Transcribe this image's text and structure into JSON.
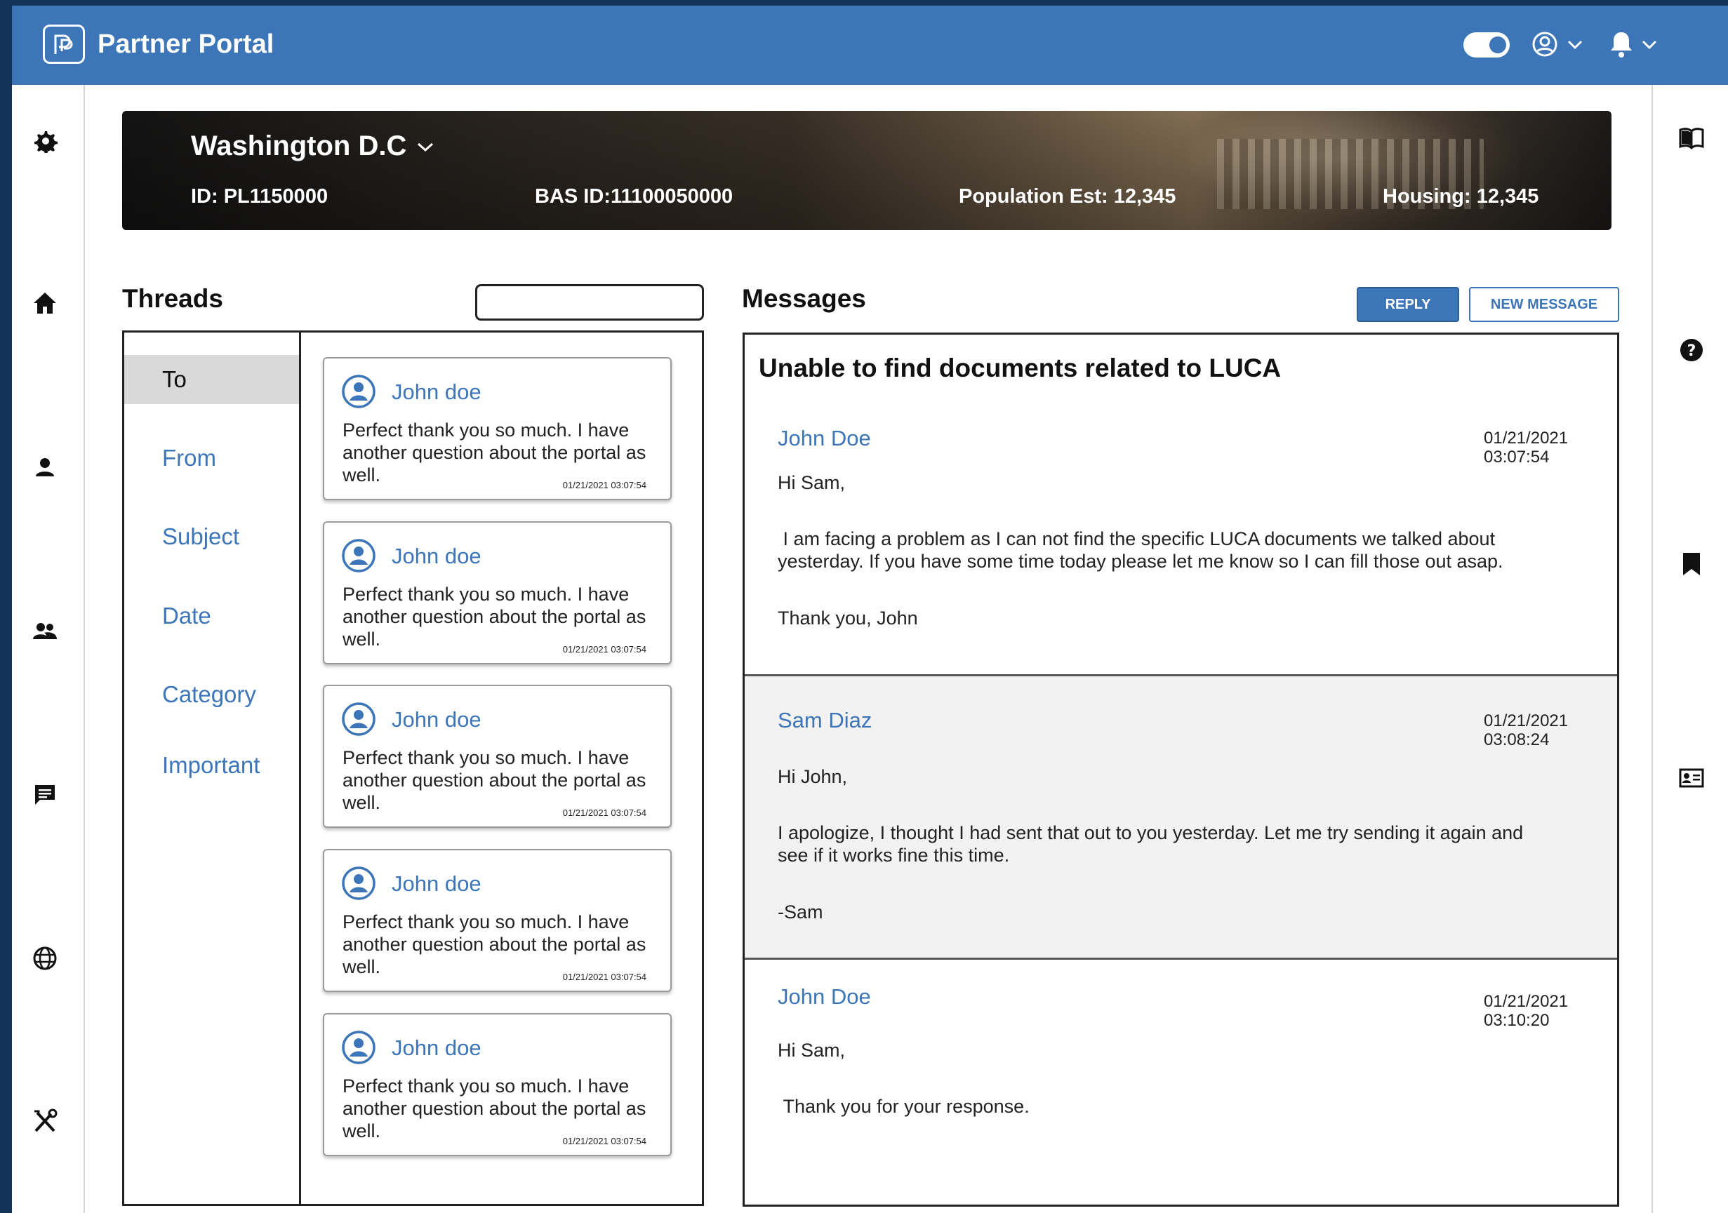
{
  "app": {
    "title": "Partner Portal",
    "accent_color": "#3d76b8"
  },
  "header_icons": [
    "toggle-switch",
    "user-circle-icon",
    "chevron-down-icon",
    "bell-icon",
    "chevron-down-icon"
  ],
  "left_rail": [
    "gear-icon",
    "home-icon",
    "person-icon",
    "group-icon",
    "chat-icon",
    "globe-icon",
    "tools-icon"
  ],
  "right_rail": [
    "book-icon",
    "help-icon",
    "bookmark-icon",
    "contact-card-icon"
  ],
  "banner": {
    "location": "Washington D.C",
    "id": "ID: PL1150000",
    "bas_id": "BAS ID:11100050000",
    "population": "Population Est: 12,345",
    "housing": "Housing: 12,345"
  },
  "threads": {
    "title": "Threads",
    "search_value": "",
    "filters": [
      "To",
      "From",
      "Subject",
      "Date",
      "Category",
      "Important"
    ],
    "active_filter": "To",
    "cards": [
      {
        "name": "John doe",
        "preview": "Perfect thank you so much. I have another question about the portal as well.",
        "time": "01/21/2021 03:07:54"
      },
      {
        "name": "John doe",
        "preview": "Perfect thank you so much. I have another question about the portal as well.",
        "time": "01/21/2021 03:07:54"
      },
      {
        "name": "John doe",
        "preview": "Perfect thank you so much. I have another question about the portal as well.",
        "time": "01/21/2021 03:07:54"
      },
      {
        "name": "John doe",
        "preview": "Perfect thank you so much. I have another question about the portal as well.",
        "time": "01/21/2021 03:07:54"
      },
      {
        "name": "John doe",
        "preview": "Perfect thank you so much. I have another question about the portal as well.",
        "time": "01/21/2021 03:07:54"
      }
    ]
  },
  "messages": {
    "title": "Messages",
    "reply_label": "REPLY",
    "new_message_label": "NEW MESSAGE",
    "subject": "Unable to find documents related to LUCA",
    "items": [
      {
        "author": "John Doe",
        "date": "01/21/2021",
        "time": "03:07:54",
        "lines": [
          "Hi Sam,",
          " I am facing a problem as I can not find the specific LUCA documents we talked about yesterday. If you have some time today please let me know so I can fill those out asap.",
          "Thank you, John"
        ]
      },
      {
        "author": "Sam Diaz",
        "date": "01/21/2021",
        "time": "03:08:24",
        "lines": [
          "Hi John,",
          "I apologize, I thought I had sent that out to you yesterday. Let me try sending it again and see if it works fine this time.",
          "-Sam"
        ]
      },
      {
        "author": "John Doe",
        "date": "01/21/2021",
        "time": "03:10:20",
        "lines": [
          "Hi Sam,",
          " Thank you for your response."
        ]
      }
    ]
  }
}
